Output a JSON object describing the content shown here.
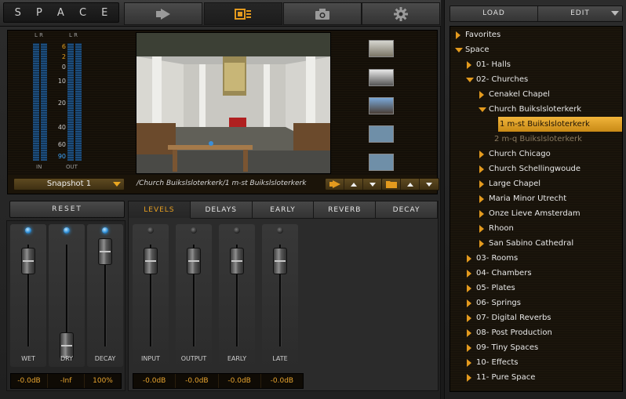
{
  "app": {
    "logo_letters": [
      "S",
      "P",
      "A",
      "C",
      "E"
    ]
  },
  "topbar": {
    "tabs": [
      {
        "icon": "play-icon"
      },
      {
        "icon": "layout-icon",
        "active": true
      },
      {
        "icon": "camera-icon"
      },
      {
        "icon": "gear-icon"
      }
    ]
  },
  "meters": {
    "left_top": "L R",
    "right_top": "L R",
    "in_label": "IN",
    "out_label": "OUT",
    "scale": [
      "6",
      "2",
      "0",
      "10",
      "20",
      "40",
      "60",
      "90"
    ]
  },
  "display": {
    "snapshot_label": "Snapshot 1",
    "path": "/Church Buikslsloterkerk/1 m-st Buikslsloterkerk"
  },
  "controls": {
    "reset_label": "RESET",
    "tabs": [
      "LEVELS",
      "DELAYS",
      "EARLY",
      "REVERB",
      "DECAY"
    ],
    "active_tab": "LEVELS",
    "left_strips": [
      {
        "label": "WET",
        "value": "-0.0dB",
        "led_on": true,
        "level": 0.9
      },
      {
        "label": "DRY",
        "value": "-Inf",
        "led_on": true,
        "level": 0.0
      },
      {
        "label": "DECAY",
        "value": "100%",
        "led_on": true,
        "level": 1.0
      }
    ],
    "right_strips": [
      {
        "label": "INPUT",
        "value": "-0.0dB",
        "led_on": false,
        "level": 0.9
      },
      {
        "label": "OUTPUT",
        "value": "-0.0dB",
        "led_on": false,
        "level": 0.9
      },
      {
        "label": "EARLY",
        "value": "-0.0dB",
        "led_on": false,
        "level": 0.9
      },
      {
        "label": "LATE",
        "value": "-0.0dB",
        "led_on": false,
        "level": 0.9
      }
    ]
  },
  "browser": {
    "load_label": "LOAD",
    "edit_label": "EDIT",
    "tree": [
      {
        "label": "Favorites",
        "depth": 0,
        "state": "closed"
      },
      {
        "label": "Space",
        "depth": 0,
        "state": "open"
      },
      {
        "label": "01- Halls",
        "depth": 1,
        "state": "closed"
      },
      {
        "label": "02- Churches",
        "depth": 1,
        "state": "open"
      },
      {
        "label": "Cenakel Chapel",
        "depth": 2,
        "state": "closed"
      },
      {
        "label": "Church Buikslsloterkerk",
        "depth": 2,
        "state": "open"
      },
      {
        "label": "1 m-st Buikslsloterkerk",
        "depth": 3,
        "state": "leaf",
        "selected": true
      },
      {
        "label": "2 m-q Buikslsloterkerk",
        "depth": 3,
        "state": "leaf",
        "dim": true
      },
      {
        "label": "Church Chicago",
        "depth": 2,
        "state": "closed"
      },
      {
        "label": "Church Schellingwoude",
        "depth": 2,
        "state": "closed"
      },
      {
        "label": "Large Chapel",
        "depth": 2,
        "state": "closed"
      },
      {
        "label": "Maria Minor Utrecht",
        "depth": 2,
        "state": "closed"
      },
      {
        "label": "Onze Lieve Amsterdam",
        "depth": 2,
        "state": "closed"
      },
      {
        "label": "Rhoon",
        "depth": 2,
        "state": "closed"
      },
      {
        "label": "San Sabino Cathedral",
        "depth": 2,
        "state": "closed"
      },
      {
        "label": "03- Rooms",
        "depth": 1,
        "state": "closed"
      },
      {
        "label": "04- Chambers",
        "depth": 1,
        "state": "closed"
      },
      {
        "label": "05- Plates",
        "depth": 1,
        "state": "closed"
      },
      {
        "label": "06- Springs",
        "depth": 1,
        "state": "closed"
      },
      {
        "label": "07- Digital Reverbs",
        "depth": 1,
        "state": "closed"
      },
      {
        "label": "08- Post Production",
        "depth": 1,
        "state": "closed"
      },
      {
        "label": "09- Tiny Spaces",
        "depth": 1,
        "state": "closed"
      },
      {
        "label": "10- Effects",
        "depth": 1,
        "state": "closed"
      },
      {
        "label": "11- Pure Space",
        "depth": 1,
        "state": "closed"
      }
    ]
  },
  "colors": {
    "accent": "#e39a1e",
    "led": "#2f9be8",
    "value_text": "#e8a530"
  }
}
